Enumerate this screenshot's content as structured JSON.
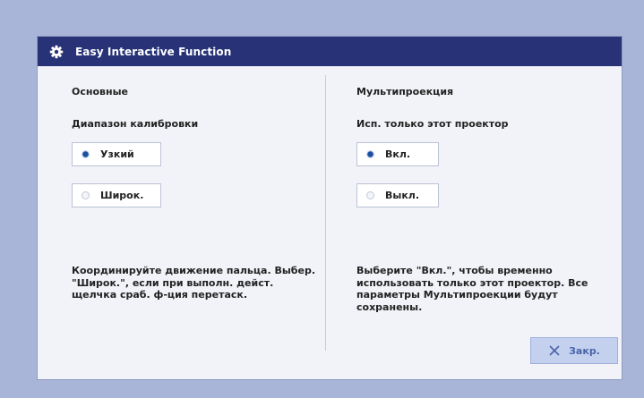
{
  "window": {
    "title": "Easy Interactive Function",
    "title_icon": "gear-icon"
  },
  "left": {
    "section_title": "Основные",
    "option_label": "Диапазон калибровки",
    "options": [
      {
        "label": "Узкий",
        "selected": true
      },
      {
        "label": "Широк.",
        "selected": false
      }
    ],
    "description": "Координируйте движение пальца. Выбер. \"Широк.\", если при выполн. дейст. щелчка сраб. ф-ция перетаск."
  },
  "right": {
    "section_title": "Мультипроекция",
    "option_label": "Исп. только этот проектор",
    "options": [
      {
        "label": "Вкл.",
        "selected": true
      },
      {
        "label": "Выкл.",
        "selected": false
      }
    ],
    "description": "Выберите \"Вкл.\", чтобы временно использовать только этот проектор. Все параметры Мультипроекции будут сохранены."
  },
  "footer": {
    "close_label": "Закр.",
    "close_icon": "close-icon"
  },
  "colors": {
    "background": "#a9b5d8",
    "titlebar": "#273277",
    "panel": "#f1f3f8",
    "accent": "#1b4fa0",
    "close_button": "#c3d0ee"
  }
}
